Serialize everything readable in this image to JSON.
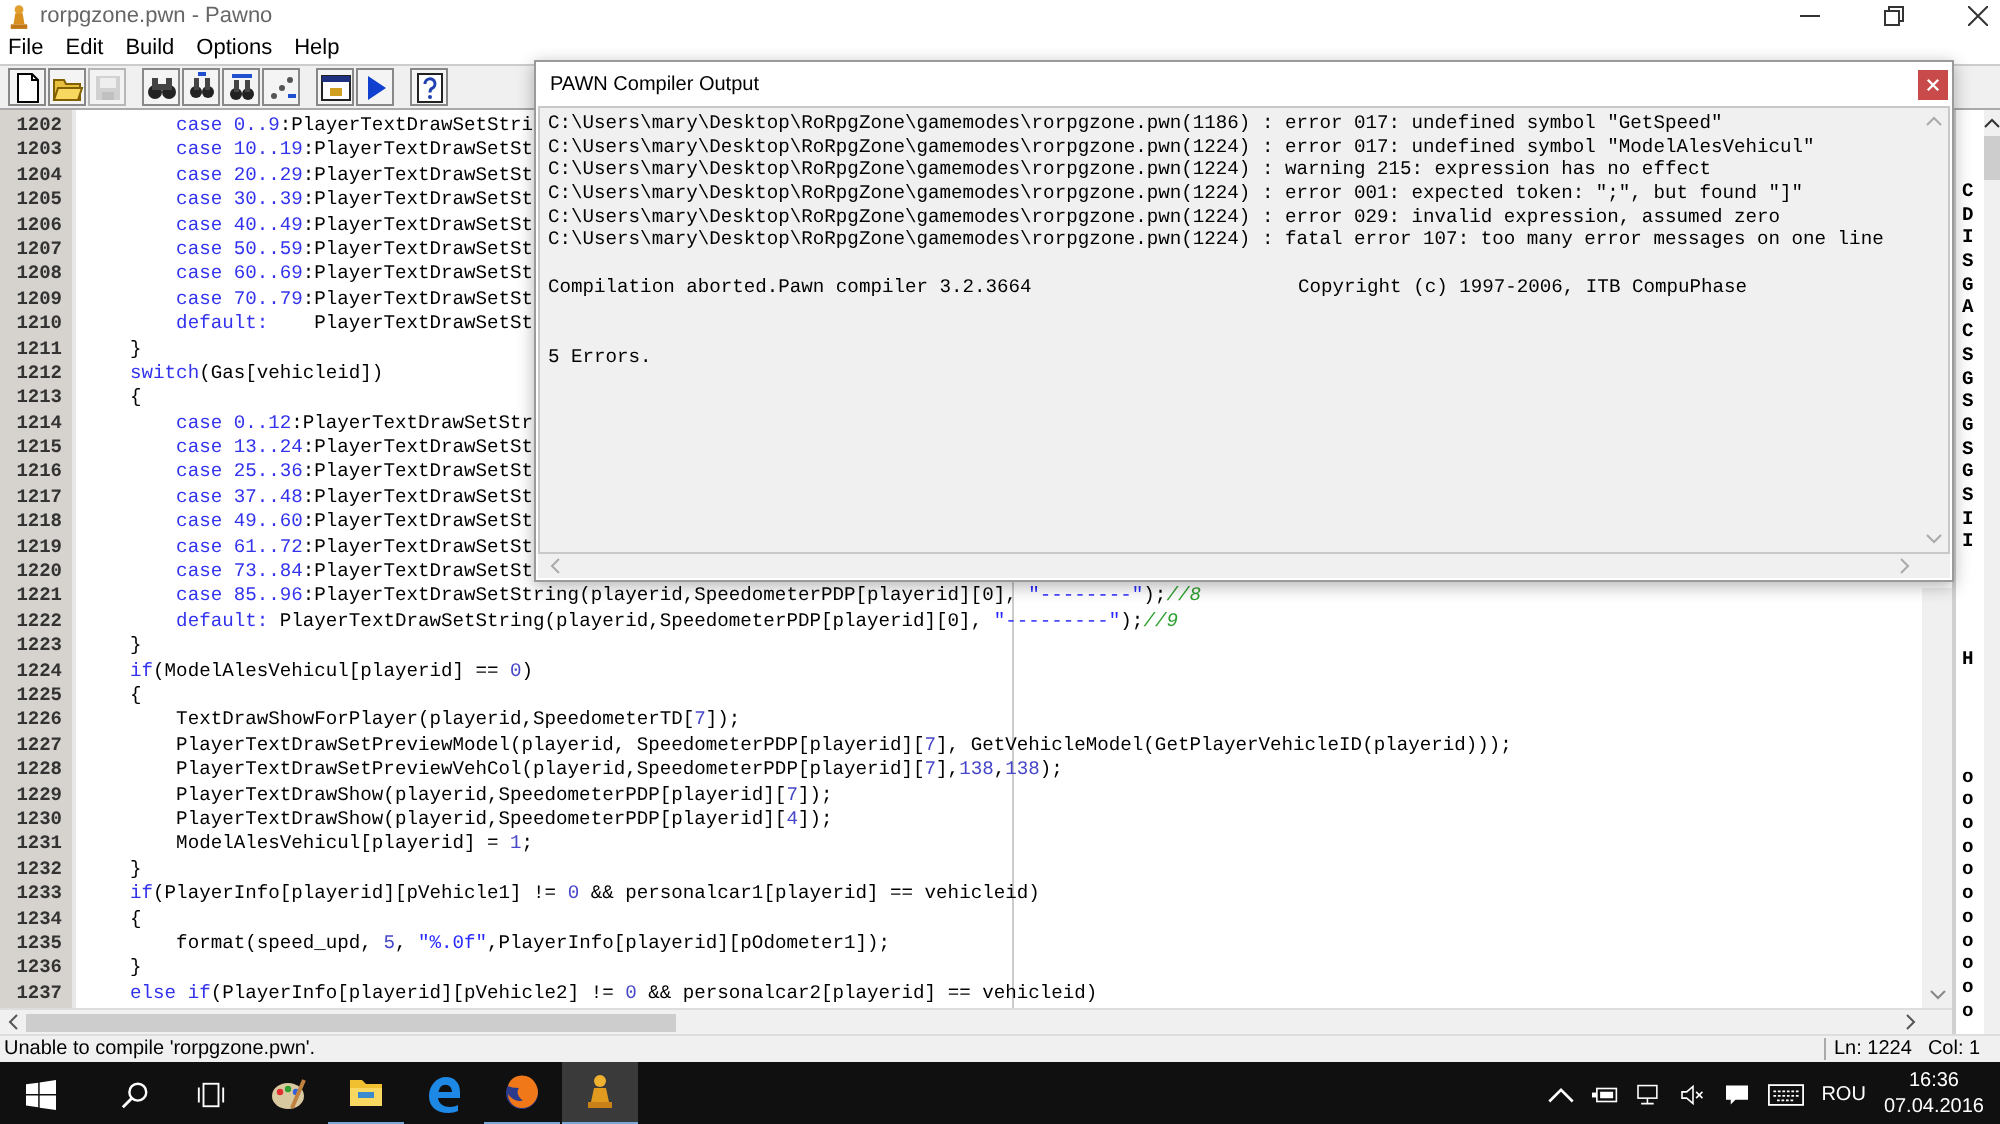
{
  "window": {
    "title": "rorpgzone.pwn - Pawno"
  },
  "menu": [
    "File",
    "Edit",
    "Build",
    "Options",
    "Help"
  ],
  "toolbar": [
    {
      "kind": "new",
      "disabled": false
    },
    {
      "kind": "open",
      "disabled": false
    },
    {
      "kind": "save",
      "disabled": true
    },
    {
      "kind": "separator"
    },
    {
      "kind": "find",
      "disabled": false
    },
    {
      "kind": "find-next",
      "disabled": false
    },
    {
      "kind": "replace",
      "disabled": false
    },
    {
      "kind": "goto",
      "disabled": false
    },
    {
      "kind": "separator"
    },
    {
      "kind": "compile",
      "disabled": false
    },
    {
      "kind": "run",
      "disabled": false
    },
    {
      "kind": "separator"
    },
    {
      "kind": "help",
      "disabled": false
    }
  ],
  "editor": {
    "lines": [
      {
        "number": "1202",
        "tokens": [
          {
            "text": "        case 0..9",
            "kind": "kw"
          },
          {
            "text": ":PlayerTextDrawSetStri"
          }
        ]
      },
      {
        "number": "1203",
        "tokens": [
          {
            "text": "        case 10..19",
            "kind": "kw"
          },
          {
            "text": ":PlayerTextDrawSetSt"
          }
        ]
      },
      {
        "number": "1204",
        "tokens": [
          {
            "text": "        case 20..29",
            "kind": "kw"
          },
          {
            "text": ":PlayerTextDrawSetSt"
          }
        ]
      },
      {
        "number": "1205",
        "tokens": [
          {
            "text": "        case 30..39",
            "kind": "kw"
          },
          {
            "text": ":PlayerTextDrawSetSt"
          }
        ]
      },
      {
        "number": "1206",
        "tokens": [
          {
            "text": "        case 40..49",
            "kind": "kw"
          },
          {
            "text": ":PlayerTextDrawSetSt"
          }
        ]
      },
      {
        "number": "1207",
        "tokens": [
          {
            "text": "        case 50..59",
            "kind": "kw"
          },
          {
            "text": ":PlayerTextDrawSetSt"
          }
        ]
      },
      {
        "number": "1208",
        "tokens": [
          {
            "text": "        case 60..69",
            "kind": "kw"
          },
          {
            "text": ":PlayerTextDrawSetSt"
          }
        ]
      },
      {
        "number": "1209",
        "tokens": [
          {
            "text": "        case 70..79",
            "kind": "kw"
          },
          {
            "text": ":PlayerTextDrawSetSt"
          }
        ]
      },
      {
        "number": "1210",
        "tokens": [
          {
            "text": "        default:",
            "kind": "kw"
          },
          {
            "text": "    PlayerTextDrawSetSt"
          }
        ]
      },
      {
        "number": "1211",
        "tokens": [
          {
            "text": "    }"
          }
        ]
      },
      {
        "number": "1212",
        "tokens": [
          {
            "text": "    switch",
            "kind": "kw"
          },
          {
            "text": "(Gas[vehicleid])"
          }
        ]
      },
      {
        "number": "1213",
        "tokens": [
          {
            "text": "    {"
          }
        ]
      },
      {
        "number": "1214",
        "tokens": [
          {
            "text": "        case 0..12",
            "kind": "kw"
          },
          {
            "text": ":PlayerTextDrawSetStr"
          }
        ]
      },
      {
        "number": "1215",
        "tokens": [
          {
            "text": "        case 13..24",
            "kind": "kw"
          },
          {
            "text": ":PlayerTextDrawSetSt"
          }
        ]
      },
      {
        "number": "1216",
        "tokens": [
          {
            "text": "        case 25..36",
            "kind": "kw"
          },
          {
            "text": ":PlayerTextDrawSetSt"
          }
        ]
      },
      {
        "number": "1217",
        "tokens": [
          {
            "text": "        case 37..48",
            "kind": "kw"
          },
          {
            "text": ":PlayerTextDrawSetSt"
          }
        ]
      },
      {
        "number": "1218",
        "tokens": [
          {
            "text": "        case 49..60",
            "kind": "kw"
          },
          {
            "text": ":PlayerTextDrawSetSt"
          }
        ]
      },
      {
        "number": "1219",
        "tokens": [
          {
            "text": "        case 61..72",
            "kind": "kw"
          },
          {
            "text": ":PlayerTextDrawSetSt"
          }
        ]
      },
      {
        "number": "1220",
        "tokens": [
          {
            "text": "        case 73..84",
            "kind": "kw"
          },
          {
            "text": ":PlayerTextDrawSetSt"
          }
        ]
      },
      {
        "number": "1221",
        "tokens": [
          {
            "text": "        case 85..96",
            "kind": "kw"
          },
          {
            "text": ":PlayerTextDrawSetString(playerid,SpeedometerPDP[playerid][0], "
          },
          {
            "text": "\"--------\"",
            "kind": "str"
          },
          {
            "text": ");"
          },
          {
            "text": "//8",
            "kind": "comment"
          }
        ]
      },
      {
        "number": "1222",
        "tokens": [
          {
            "text": "        default:",
            "kind": "kw"
          },
          {
            "text": " PlayerTextDrawSetString(playerid,SpeedometerPDP[playerid][0], "
          },
          {
            "text": "\"---------\"",
            "kind": "str"
          },
          {
            "text": ");"
          },
          {
            "text": "//9",
            "kind": "comment"
          }
        ]
      },
      {
        "number": "1223",
        "tokens": [
          {
            "text": "    }"
          }
        ]
      },
      {
        "number": "1224",
        "tokens": [
          {
            "text": "    if",
            "kind": "kw"
          },
          {
            "text": "(ModelAlesVehicul[playerid] == "
          },
          {
            "text": "0",
            "kind": "num"
          },
          {
            "text": ")"
          }
        ]
      },
      {
        "number": "1225",
        "tokens": [
          {
            "text": "    {"
          }
        ]
      },
      {
        "number": "1226",
        "tokens": [
          {
            "text": "        TextDrawShowForPlayer(playerid,SpeedometerTD["
          },
          {
            "text": "7",
            "kind": "num"
          },
          {
            "text": "]);"
          }
        ]
      },
      {
        "number": "1227",
        "tokens": [
          {
            "text": "        PlayerTextDrawSetPreviewModel(playerid, SpeedometerPDP[playerid]["
          },
          {
            "text": "7",
            "kind": "num"
          },
          {
            "text": "], GetVehicleModel(GetPlayerVehicleID(playerid)));"
          }
        ]
      },
      {
        "number": "1228",
        "tokens": [
          {
            "text": "        PlayerTextDrawSetPreviewVehCol(playerid,SpeedometerPDP[playerid]["
          },
          {
            "text": "7",
            "kind": "num"
          },
          {
            "text": "],"
          },
          {
            "text": "138",
            "kind": "num"
          },
          {
            "text": ","
          },
          {
            "text": "138",
            "kind": "num"
          },
          {
            "text": ");"
          }
        ]
      },
      {
        "number": "1229",
        "tokens": [
          {
            "text": "        PlayerTextDrawShow(playerid,SpeedometerPDP[playerid]["
          },
          {
            "text": "7",
            "kind": "num"
          },
          {
            "text": "]);"
          }
        ]
      },
      {
        "number": "1230",
        "tokens": [
          {
            "text": "        PlayerTextDrawShow(playerid,SpeedometerPDP[playerid]["
          },
          {
            "text": "4",
            "kind": "num"
          },
          {
            "text": "]);"
          }
        ]
      },
      {
        "number": "1231",
        "tokens": [
          {
            "text": "        ModelAlesVehicul[playerid] = "
          },
          {
            "text": "1",
            "kind": "num"
          },
          {
            "text": ";"
          }
        ]
      },
      {
        "number": "1232",
        "tokens": [
          {
            "text": "    }"
          }
        ]
      },
      {
        "number": "1233",
        "tokens": [
          {
            "text": "    if",
            "kind": "kw"
          },
          {
            "text": "(PlayerInfo[playerid][pVehicle1] != "
          },
          {
            "text": "0",
            "kind": "num"
          },
          {
            "text": " && personalcar1[playerid] == vehicleid)"
          }
        ]
      },
      {
        "number": "1234",
        "tokens": [
          {
            "text": "    {"
          }
        ]
      },
      {
        "number": "1235",
        "tokens": [
          {
            "text": "        format(speed_upd, "
          },
          {
            "text": "5",
            "kind": "num"
          },
          {
            "text": ", "
          },
          {
            "text": "\"%.0f\"",
            "kind": "str"
          },
          {
            "text": ",PlayerInfo[playerid][pOdometer1]);"
          }
        ]
      },
      {
        "number": "1236",
        "tokens": [
          {
            "text": "    }"
          }
        ]
      },
      {
        "number": "1237",
        "tokens": [
          {
            "text": "    else if",
            "kind": "kw"
          },
          {
            "text": "(PlayerInfo[playerid][pVehicle2] != "
          },
          {
            "text": "0",
            "kind": "num"
          },
          {
            "text": " && personalcar2[playerid] == vehicleid)"
          }
        ]
      }
    ]
  },
  "function_list": {
    "groups": [
      [
        "C",
        "D",
        "I",
        "S",
        "G",
        "A",
        "C",
        "S",
        "G",
        "S",
        "G",
        "S",
        "G",
        "S",
        "I",
        "I"
      ],
      [
        "H"
      ],
      [
        "o",
        "o",
        "o",
        "o",
        "o",
        "o",
        "o",
        "o",
        "o",
        "o",
        "o"
      ]
    ]
  },
  "status_bar": {
    "message": "Unable to compile 'rorpgzone.pwn'.",
    "line": "Ln: 1224",
    "column": "Col: 1"
  },
  "compiler_output": {
    "title": "PAWN Compiler Output",
    "lines": [
      "C:\\Users\\mary\\Desktop\\RoRpgZone\\gamemodes\\rorpgzone.pwn(1186) : error 017: undefined symbol \"GetSpeed\"",
      "C:\\Users\\mary\\Desktop\\RoRpgZone\\gamemodes\\rorpgzone.pwn(1224) : error 017: undefined symbol \"ModelAlesVehicul\"",
      "C:\\Users\\mary\\Desktop\\RoRpgZone\\gamemodes\\rorpgzone.pwn(1224) : warning 215: expression has no effect",
      "C:\\Users\\mary\\Desktop\\RoRpgZone\\gamemodes\\rorpgzone.pwn(1224) : error 001: expected token: \";\", but found \"]\"",
      "C:\\Users\\mary\\Desktop\\RoRpgZone\\gamemodes\\rorpgzone.pwn(1224) : error 029: invalid expression, assumed zero",
      "C:\\Users\\mary\\Desktop\\RoRpgZone\\gamemodes\\rorpgzone.pwn(1224) : fatal error 107: too many error messages on one line"
    ],
    "summary": "Compilation aborted.Pawn compiler 3.2.3664",
    "copyright": "Copyright (c) 1997-2006, ITB CompuPhase",
    "result": "5 Errors."
  },
  "taskbar": {
    "items": [
      {
        "kind": "paint",
        "running": false,
        "selected": false
      },
      {
        "kind": "explorer",
        "running": true,
        "selected": false
      },
      {
        "kind": "edge",
        "running": false,
        "selected": false
      },
      {
        "kind": "firefox",
        "running": true,
        "selected": false
      },
      {
        "kind": "pawno",
        "running": true,
        "selected": true
      }
    ],
    "language": "ROU",
    "time": "16:36",
    "date": "07.04.2016"
  }
}
